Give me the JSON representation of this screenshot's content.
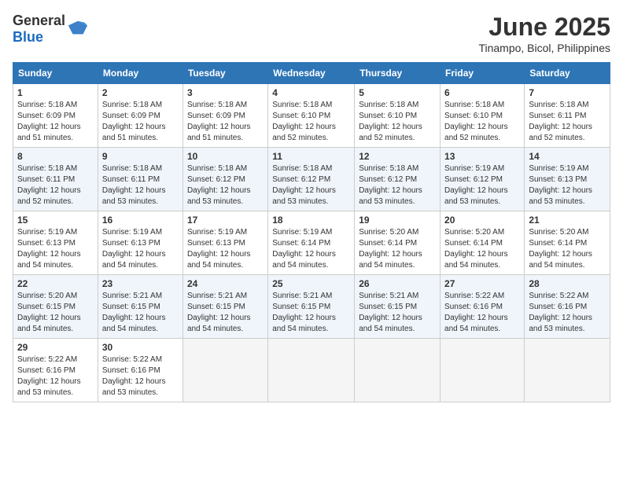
{
  "header": {
    "logo_general": "General",
    "logo_blue": "Blue",
    "month_title": "June 2025",
    "location": "Tinampo, Bicol, Philippines"
  },
  "weekdays": [
    "Sunday",
    "Monday",
    "Tuesday",
    "Wednesday",
    "Thursday",
    "Friday",
    "Saturday"
  ],
  "weeks": [
    [
      {
        "day": "1",
        "sunrise": "5:18 AM",
        "sunset": "6:09 PM",
        "daylight": "12 hours and 51 minutes."
      },
      {
        "day": "2",
        "sunrise": "5:18 AM",
        "sunset": "6:09 PM",
        "daylight": "12 hours and 51 minutes."
      },
      {
        "day": "3",
        "sunrise": "5:18 AM",
        "sunset": "6:09 PM",
        "daylight": "12 hours and 51 minutes."
      },
      {
        "day": "4",
        "sunrise": "5:18 AM",
        "sunset": "6:10 PM",
        "daylight": "12 hours and 52 minutes."
      },
      {
        "day": "5",
        "sunrise": "5:18 AM",
        "sunset": "6:10 PM",
        "daylight": "12 hours and 52 minutes."
      },
      {
        "day": "6",
        "sunrise": "5:18 AM",
        "sunset": "6:10 PM",
        "daylight": "12 hours and 52 minutes."
      },
      {
        "day": "7",
        "sunrise": "5:18 AM",
        "sunset": "6:11 PM",
        "daylight": "12 hours and 52 minutes."
      }
    ],
    [
      {
        "day": "8",
        "sunrise": "5:18 AM",
        "sunset": "6:11 PM",
        "daylight": "12 hours and 52 minutes."
      },
      {
        "day": "9",
        "sunrise": "5:18 AM",
        "sunset": "6:11 PM",
        "daylight": "12 hours and 53 minutes."
      },
      {
        "day": "10",
        "sunrise": "5:18 AM",
        "sunset": "6:12 PM",
        "daylight": "12 hours and 53 minutes."
      },
      {
        "day": "11",
        "sunrise": "5:18 AM",
        "sunset": "6:12 PM",
        "daylight": "12 hours and 53 minutes."
      },
      {
        "day": "12",
        "sunrise": "5:18 AM",
        "sunset": "6:12 PM",
        "daylight": "12 hours and 53 minutes."
      },
      {
        "day": "13",
        "sunrise": "5:19 AM",
        "sunset": "6:12 PM",
        "daylight": "12 hours and 53 minutes."
      },
      {
        "day": "14",
        "sunrise": "5:19 AM",
        "sunset": "6:13 PM",
        "daylight": "12 hours and 53 minutes."
      }
    ],
    [
      {
        "day": "15",
        "sunrise": "5:19 AM",
        "sunset": "6:13 PM",
        "daylight": "12 hours and 54 minutes."
      },
      {
        "day": "16",
        "sunrise": "5:19 AM",
        "sunset": "6:13 PM",
        "daylight": "12 hours and 54 minutes."
      },
      {
        "day": "17",
        "sunrise": "5:19 AM",
        "sunset": "6:13 PM",
        "daylight": "12 hours and 54 minutes."
      },
      {
        "day": "18",
        "sunrise": "5:19 AM",
        "sunset": "6:14 PM",
        "daylight": "12 hours and 54 minutes."
      },
      {
        "day": "19",
        "sunrise": "5:20 AM",
        "sunset": "6:14 PM",
        "daylight": "12 hours and 54 minutes."
      },
      {
        "day": "20",
        "sunrise": "5:20 AM",
        "sunset": "6:14 PM",
        "daylight": "12 hours and 54 minutes."
      },
      {
        "day": "21",
        "sunrise": "5:20 AM",
        "sunset": "6:14 PM",
        "daylight": "12 hours and 54 minutes."
      }
    ],
    [
      {
        "day": "22",
        "sunrise": "5:20 AM",
        "sunset": "6:15 PM",
        "daylight": "12 hours and 54 minutes."
      },
      {
        "day": "23",
        "sunrise": "5:21 AM",
        "sunset": "6:15 PM",
        "daylight": "12 hours and 54 minutes."
      },
      {
        "day": "24",
        "sunrise": "5:21 AM",
        "sunset": "6:15 PM",
        "daylight": "12 hours and 54 minutes."
      },
      {
        "day": "25",
        "sunrise": "5:21 AM",
        "sunset": "6:15 PM",
        "daylight": "12 hours and 54 minutes."
      },
      {
        "day": "26",
        "sunrise": "5:21 AM",
        "sunset": "6:15 PM",
        "daylight": "12 hours and 54 minutes."
      },
      {
        "day": "27",
        "sunrise": "5:22 AM",
        "sunset": "6:16 PM",
        "daylight": "12 hours and 54 minutes."
      },
      {
        "day": "28",
        "sunrise": "5:22 AM",
        "sunset": "6:16 PM",
        "daylight": "12 hours and 53 minutes."
      }
    ],
    [
      {
        "day": "29",
        "sunrise": "5:22 AM",
        "sunset": "6:16 PM",
        "daylight": "12 hours and 53 minutes."
      },
      {
        "day": "30",
        "sunrise": "5:22 AM",
        "sunset": "6:16 PM",
        "daylight": "12 hours and 53 minutes."
      },
      null,
      null,
      null,
      null,
      null
    ]
  ]
}
